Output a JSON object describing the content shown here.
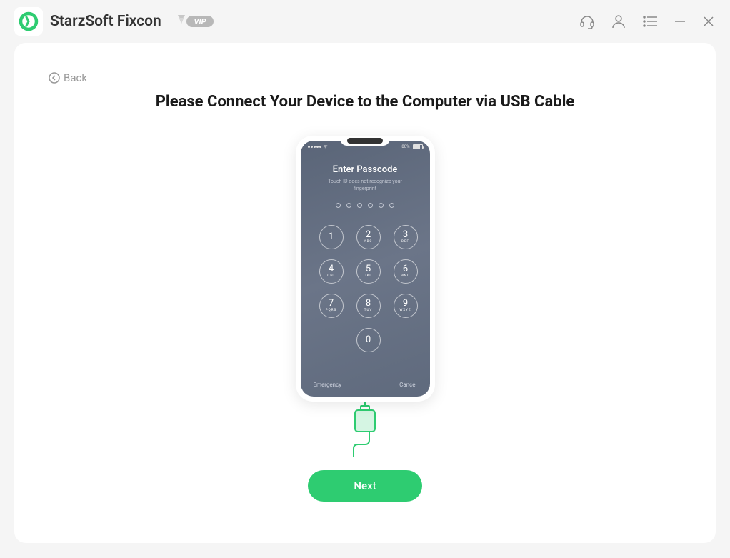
{
  "header": {
    "app_title": "StarzSoft Fixcon",
    "vip_label": "VIP"
  },
  "main": {
    "back_label": "Back",
    "heading": "Please Connect Your Device to the Computer via USB Cable",
    "next_button": "Next"
  },
  "phone": {
    "status_battery": "80%",
    "passcode_title": "Enter Passcode",
    "passcode_subtitle": "Touch ID does not recognize your fingerprint",
    "emergency_label": "Emergency",
    "cancel_label": "Cancel",
    "keys": [
      {
        "num": "1",
        "letters": ""
      },
      {
        "num": "2",
        "letters": "ABC"
      },
      {
        "num": "3",
        "letters": "DEF"
      },
      {
        "num": "4",
        "letters": "GHI"
      },
      {
        "num": "5",
        "letters": "JKL"
      },
      {
        "num": "6",
        "letters": "MNO"
      },
      {
        "num": "7",
        "letters": "PQRS"
      },
      {
        "num": "8",
        "letters": "TUV"
      },
      {
        "num": "9",
        "letters": "WXYZ"
      },
      {
        "num": "0",
        "letters": ""
      }
    ]
  }
}
